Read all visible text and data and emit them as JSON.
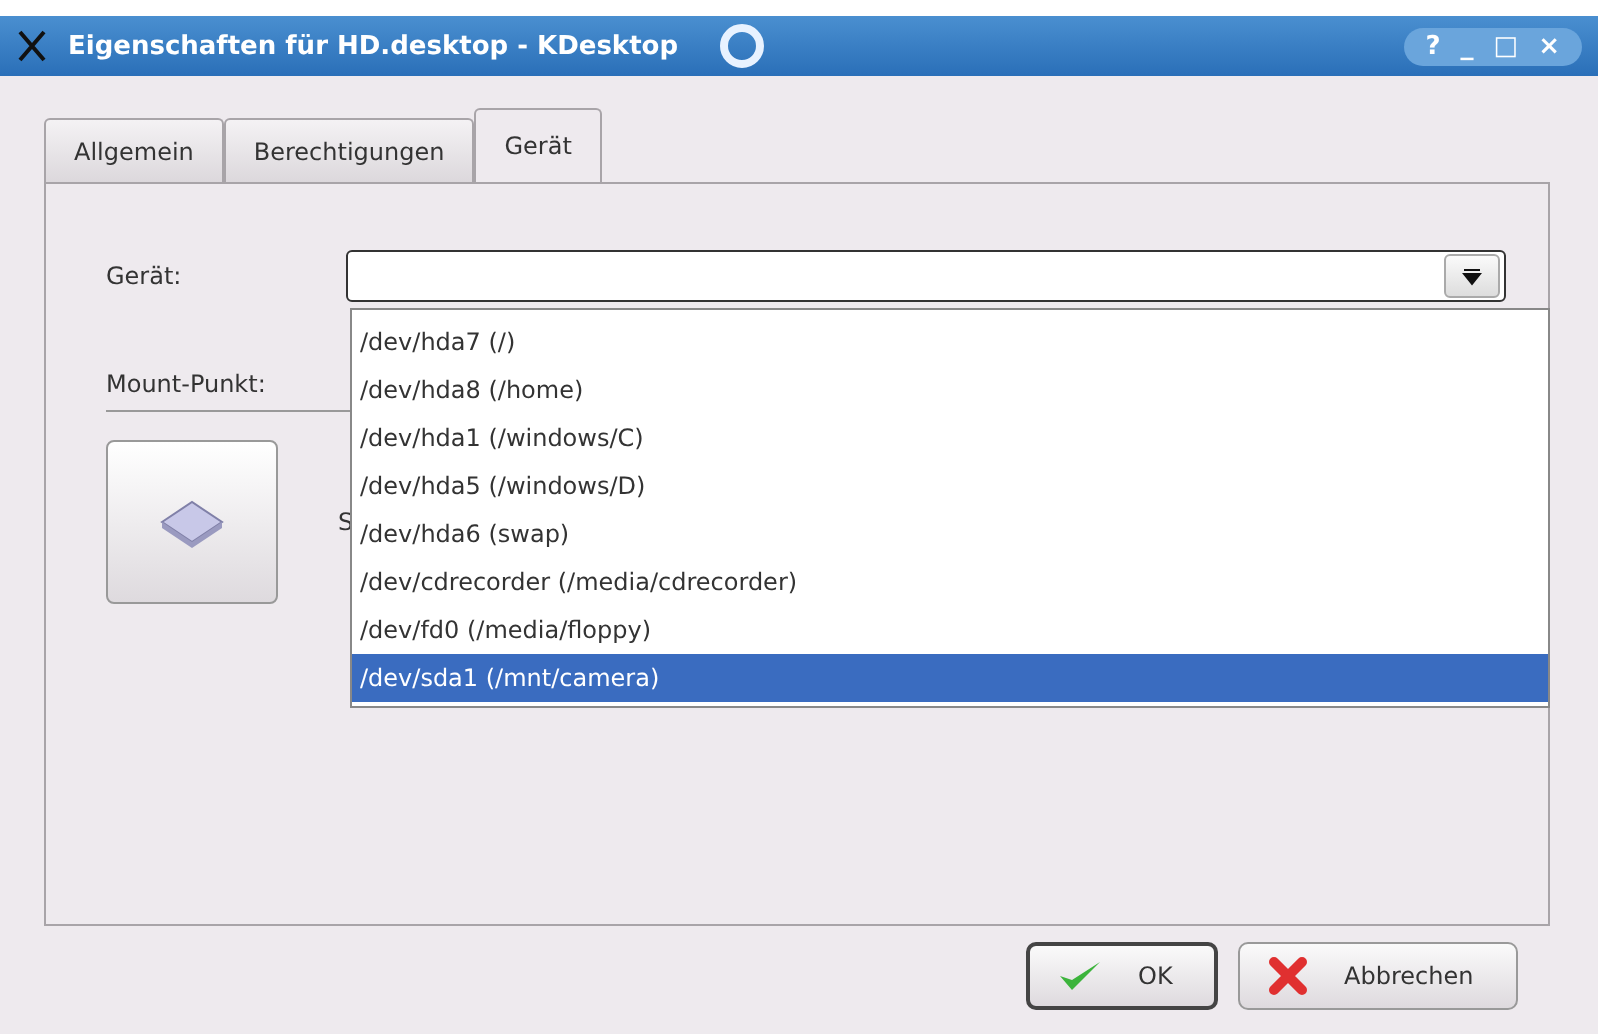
{
  "window": {
    "title": "Eigenschaften für HD.desktop - KDesktop",
    "controls": [
      "?",
      "_",
      "□",
      "×"
    ]
  },
  "tabs": [
    {
      "label": "Allgemein",
      "selected": false
    },
    {
      "label": "Berechtigungen",
      "selected": false
    },
    {
      "label": "Gerät",
      "selected": true
    }
  ],
  "device": {
    "label": "Gerät:",
    "expanded": true,
    "options": [
      {
        "label": "/dev/hda7 (/)",
        "selected": false
      },
      {
        "label": "/dev/hda8 (/home)",
        "selected": false
      },
      {
        "label": "/dev/hda1 (/windows/C)",
        "selected": false
      },
      {
        "label": "/dev/hda5 (/windows/D)",
        "selected": false
      },
      {
        "label": "/dev/hda6 (swap)",
        "selected": false
      },
      {
        "label": "/dev/cdrecorder (/media/cdrecorder)",
        "selected": false
      },
      {
        "label": "/dev/fd0 (/media/floppy)",
        "selected": false
      },
      {
        "label": "/dev/sda1 (/mnt/camera)",
        "selected": true
      }
    ]
  },
  "mount_point": {
    "label": "Mount-Punkt:"
  },
  "icon_section": {
    "label": "S"
  },
  "buttons": [
    {
      "label": "OK",
      "kind": "ok",
      "default": true
    },
    {
      "label": "Abbrechen",
      "kind": "cancel",
      "default": false
    }
  ]
}
